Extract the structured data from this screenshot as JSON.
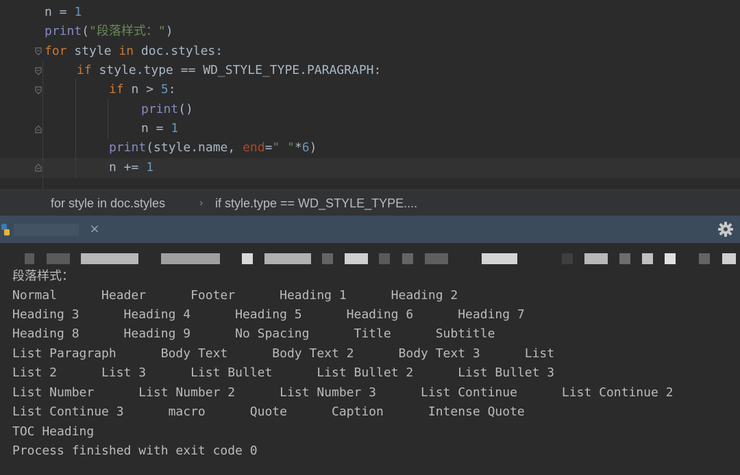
{
  "editor": {
    "code": {
      "l1": {
        "a": "n = ",
        "b": "1"
      },
      "l2": {
        "fn": "print",
        "p1": "(",
        "s": "\"段落样式：\"",
        "p2": ")"
      },
      "l3": {
        "kw1": "for",
        "mid": " style ",
        "kw2": "in",
        "rest": " doc.styles:"
      },
      "l4": {
        "kw": "if",
        "rest": " style.type == WD_STYLE_TYPE.PARAGRAPH:"
      },
      "l5": {
        "kw": "if",
        "rest": " n > ",
        "num": "5",
        ":": ":"
      },
      "l6": {
        "fn": "print",
        "rest": "()"
      },
      "l7": {
        "a": "n = ",
        "b": "1"
      },
      "l8": {
        "fn": "print",
        "a": "(style.name, ",
        "param": "end",
        "eq": "=",
        "s": "\" \"",
        "b": "*",
        "num": "6",
        ")": ")"
      },
      "l9": {
        "a": "n += ",
        "b": "1"
      }
    }
  },
  "breadcrumb": {
    "item1": "for style in doc.styles",
    "separator": "›",
    "item2": "if style.type == WD_STYLE_TYPE...."
  },
  "run_panel": {
    "close_glyph": "×"
  },
  "console": {
    "lines": [
      "段落样式：",
      "Normal      Header      Footer      Heading 1      Heading 2",
      "Heading 3      Heading 4      Heading 5      Heading 6      Heading 7",
      "Heading 8      Heading 9      No Spacing      Title      Subtitle",
      "List Paragraph      Body Text      Body Text 2      Body Text 3      List",
      "List 2      List 3      List Bullet      List Bullet 2      List Bullet 3",
      "List Number      List Number 2      List Number 3      List Continue      List Continue 2",
      "List Continue 3      macro      Quote      Caption      Intense Quote",
      "TOC Heading",
      "Process finished with exit code 0"
    ]
  },
  "colors": {
    "background": "#2b2b2b",
    "keyword": "#cc7832",
    "builtin": "#8888c6",
    "string": "#6a8759",
    "number": "#6897bb",
    "param": "#aa4926",
    "tabbar": "#3c4b5c"
  },
  "icons": {
    "fold": "fold-marker-icon",
    "close": "close-icon",
    "settings": "gear-icon",
    "run": "python-run-icon"
  }
}
